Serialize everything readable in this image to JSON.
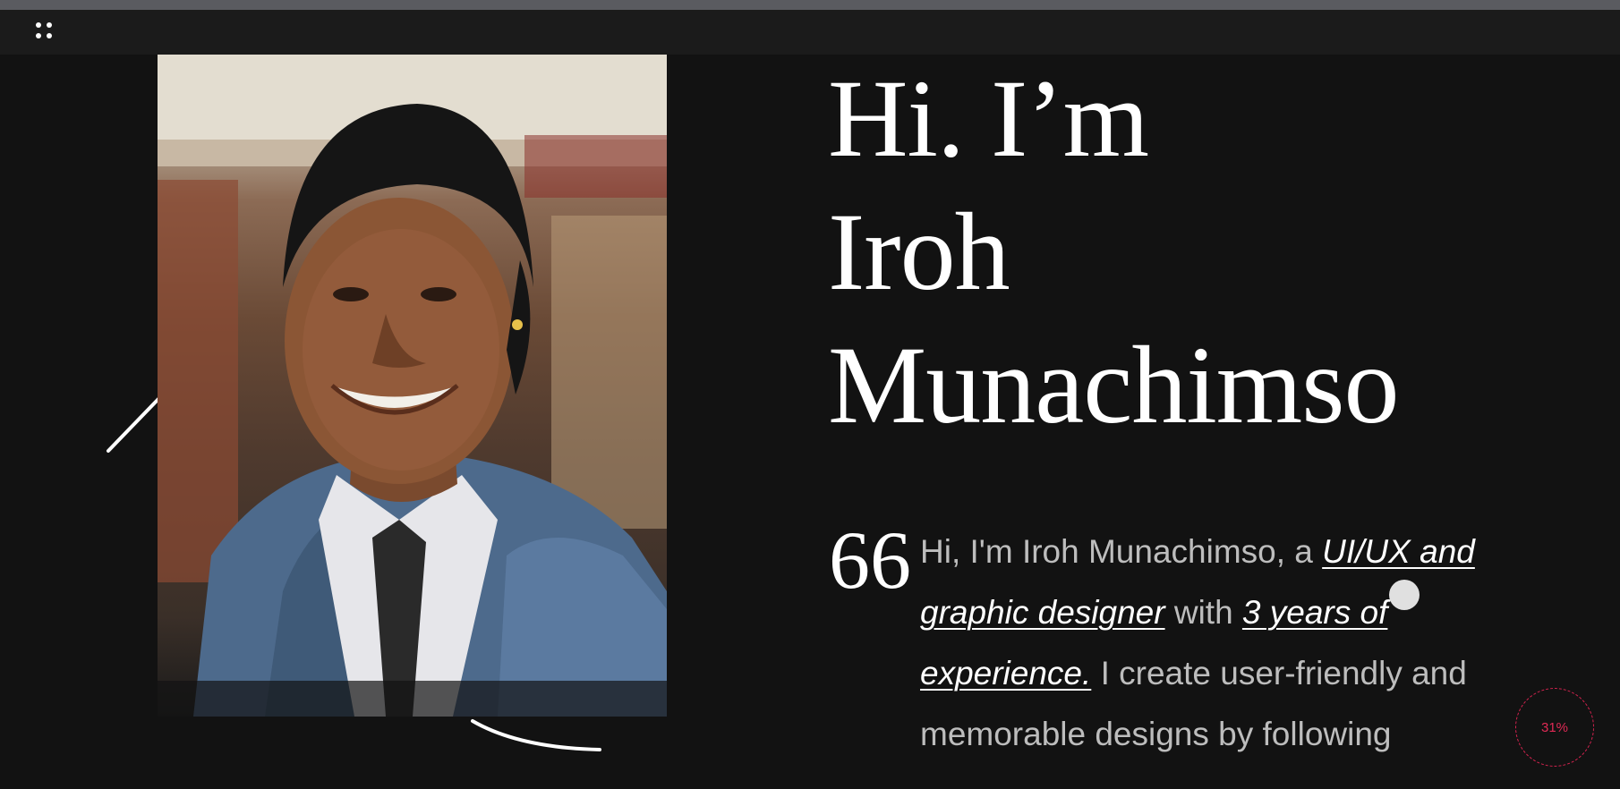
{
  "header": {
    "menu_icon": "grid-dots-icon"
  },
  "hero": {
    "title_lines": [
      "Hi. I’m",
      "Iroh",
      "Munachimso"
    ]
  },
  "portrait": {
    "alt": "Portrait photo of a smiling woman wearing a denim jacket"
  },
  "bio": {
    "quote_glyph": "66",
    "text_1": "Hi, I'm Iroh Munachimso, a ",
    "link_role": "UI/UX and graphic designer",
    "text_2": " with ",
    "link_experience": "3 years of experience.",
    "text_3": " I create user-friendly and memorable designs by following"
  },
  "scroll_progress": {
    "label": "31%",
    "value": 0.31
  },
  "colors": {
    "background": "#121212",
    "top_bar": "#1b1b1b",
    "accent_progress": "#d5234f",
    "bio_text": "#bdbdbd"
  }
}
